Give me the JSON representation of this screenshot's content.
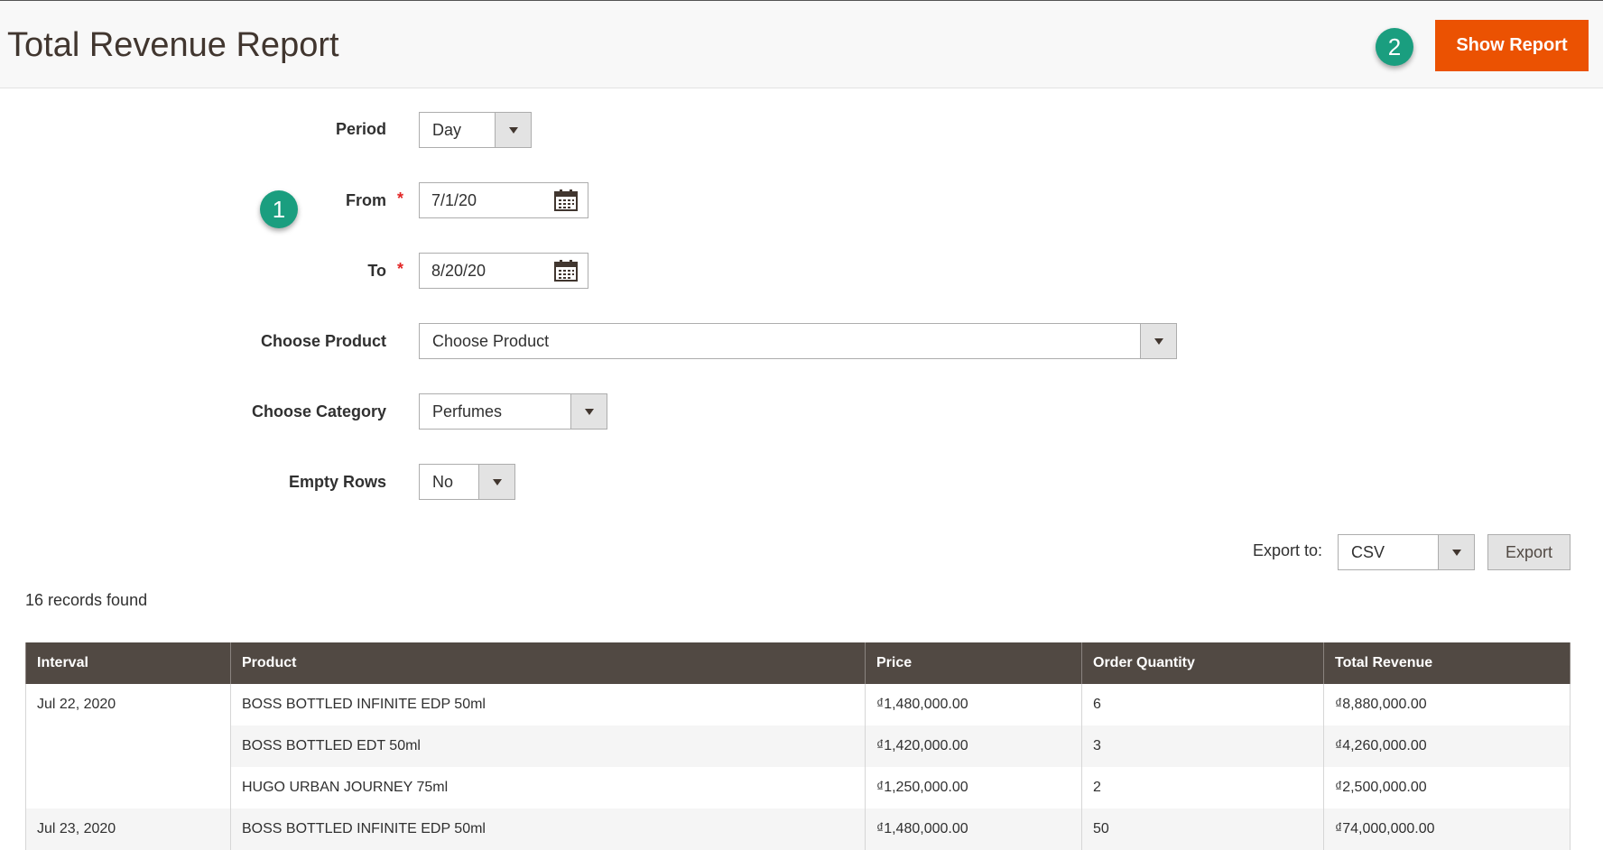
{
  "header": {
    "title": "Total Revenue Report",
    "show_report_label": "Show Report",
    "badge_1": "1",
    "badge_2": "2"
  },
  "form": {
    "period": {
      "label": "Period",
      "value": "Day"
    },
    "from": {
      "label": "From",
      "value": "7/1/20",
      "required_mark": "*"
    },
    "to": {
      "label": "To",
      "value": "8/20/20",
      "required_mark": "*"
    },
    "product": {
      "label": "Choose Product",
      "value": "Choose Product"
    },
    "category": {
      "label": "Choose Category",
      "value": "Perfumes"
    },
    "empty_rows": {
      "label": "Empty Rows",
      "value": "No"
    }
  },
  "export": {
    "label": "Export to:",
    "format": "CSV",
    "button_label": "Export"
  },
  "records_found": "16 records found",
  "grid": {
    "columns": [
      "Interval",
      "Product",
      "Price",
      "Order Quantity",
      "Total Revenue"
    ],
    "rows": [
      {
        "interval": "Jul 22, 2020",
        "product": "BOSS BOTTLED INFINITE EDP 50ml",
        "price": "₫1,480,000.00",
        "qty": "6",
        "revenue": "₫8,880,000.00"
      },
      {
        "interval": "",
        "product": "BOSS BOTTLED EDT 50ml",
        "price": "₫1,420,000.00",
        "qty": "3",
        "revenue": "₫4,260,000.00"
      },
      {
        "interval": "",
        "product": "HUGO URBAN JOURNEY 75ml",
        "price": "₫1,250,000.00",
        "qty": "2",
        "revenue": "₫2,500,000.00"
      },
      {
        "interval": "Jul 23, 2020",
        "product": "BOSS BOTTLED INFINITE EDP 50ml",
        "price": "₫1,480,000.00",
        "qty": "50",
        "revenue": "₫74,000,000.00"
      }
    ]
  },
  "colors": {
    "accent": "#eb5202",
    "badge": "#1a9e7f",
    "grid_header": "#514943"
  }
}
